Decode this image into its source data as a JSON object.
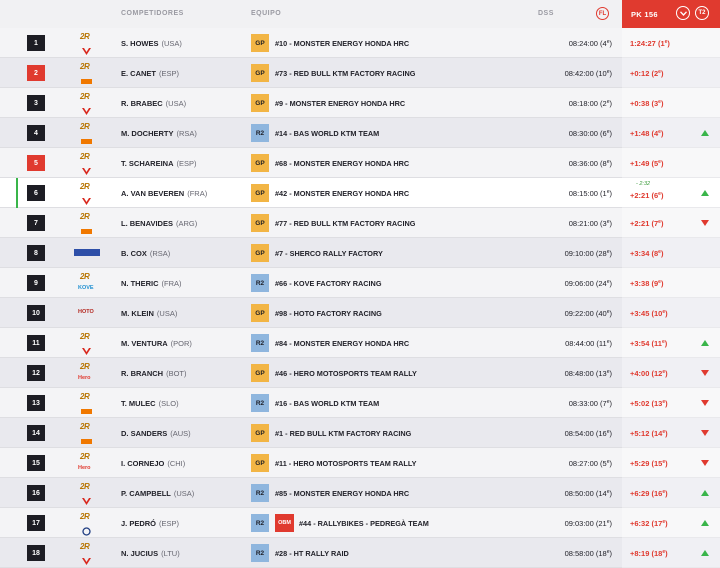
{
  "header": {
    "competitors": "COMPETIDORES",
    "team": "EQUIPO",
    "dss": "DSS",
    "flag_icon_text": "FL",
    "pk": "PK 156",
    "toggle_text": "T2"
  },
  "colors": {
    "accent": "#e03a2f",
    "gp": "#f2b545",
    "r2": "#8fb6de",
    "up": "#39b54a"
  },
  "rows": [
    {
      "rank": "1",
      "name": "S. HOWES",
      "nat": "(USA)",
      "cat": "GP",
      "team": "#10 - MONSTER ENERGY HONDA HRC",
      "dss": "08:24:00",
      "dss_pos": "4",
      "pk": "1:24:27",
      "pk_pos": "1",
      "brand": "2R",
      "mfr": "honda-icon"
    },
    {
      "rank": "2",
      "name": "E. CANET",
      "nat": "(ESP)",
      "cat": "GP",
      "team": "#73 - RED BULL KTM FACTORY RACING",
      "dss": "08:42:00",
      "dss_pos": "10",
      "pk": "+0:12",
      "pk_pos": "2",
      "brand": "2R",
      "mfr": "ktm-icon"
    },
    {
      "rank": "3",
      "name": "R. BRABEC",
      "nat": "(USA)",
      "cat": "GP",
      "team": "#9 - MONSTER ENERGY HONDA HRC",
      "dss": "08:18:00",
      "dss_pos": "2",
      "pk": "+0:38",
      "pk_pos": "3",
      "brand": "2R",
      "mfr": "honda-icon"
    },
    {
      "rank": "4",
      "name": "M. DOCHERTY",
      "nat": "(RSA)",
      "cat": "R2",
      "team": "#14 - BAS WORLD KTM TEAM",
      "dss": "08:30:00",
      "dss_pos": "6",
      "pk": "+1:48",
      "pk_pos": "4",
      "brand": "2R",
      "mfr": "ktm-icon",
      "arrow": "up"
    },
    {
      "rank": "5",
      "name": "T. SCHAREINA",
      "nat": "(ESP)",
      "cat": "GP",
      "team": "#68 - MONSTER ENERGY HONDA HRC",
      "dss": "08:36:00",
      "dss_pos": "8",
      "pk": "+1:49",
      "pk_pos": "5",
      "brand": "2R",
      "mfr": "honda-icon"
    },
    {
      "rank": "6",
      "name": "A. VAN BEVEREN",
      "nat": "(FRA)",
      "cat": "GP",
      "team": "#42 - MONSTER ENERGY HONDA HRC",
      "dss": "08:15:00",
      "dss_pos": "1",
      "pk": "+2:21",
      "pk_pos": "6",
      "penalty": "- 2:32",
      "brand": "2R",
      "mfr": "honda-icon",
      "arrow": "up"
    },
    {
      "rank": "7",
      "name": "L. BENAVIDES",
      "nat": "(ARG)",
      "cat": "GP",
      "team": "#77 - RED BULL KTM FACTORY RACING",
      "dss": "08:21:00",
      "dss_pos": "3",
      "pk": "+2:21",
      "pk_pos": "7",
      "brand": "2R",
      "mfr": "ktm-icon",
      "arrow": "down"
    },
    {
      "rank": "8",
      "name": "B. COX",
      "nat": "(RSA)",
      "cat": "GP",
      "team": "#7 - SHERCO RALLY FACTORY",
      "dss": "09:10:00",
      "dss_pos": "28",
      "pk": "+3:34",
      "pk_pos": "8",
      "logo": "sherco"
    },
    {
      "rank": "9",
      "name": "N. THERIC",
      "nat": "(FRA)",
      "cat": "R2",
      "team": "#66 - KOVE FACTORY RACING",
      "dss": "09:06:00",
      "dss_pos": "24",
      "pk": "+3:38",
      "pk_pos": "9",
      "brand": "2R",
      "logo_text": "KOVE"
    },
    {
      "rank": "10",
      "name": "M. KLEIN",
      "nat": "(USA)",
      "cat": "GP",
      "team": "#98 - HOTO FACTORY RACING",
      "dss": "09:22:00",
      "dss_pos": "40",
      "pk": "+3:45",
      "pk_pos": "10",
      "logo_text": "HOTO"
    },
    {
      "rank": "11",
      "name": "M. VENTURA",
      "nat": "(POR)",
      "cat": "R2",
      "team": "#84 - MONSTER ENERGY HONDA HRC",
      "dss": "08:44:00",
      "dss_pos": "11",
      "pk": "+3:54",
      "pk_pos": "11",
      "brand": "2R",
      "mfr": "honda-icon",
      "arrow": "up"
    },
    {
      "rank": "12",
      "name": "R. BRANCH",
      "nat": "(BOT)",
      "cat": "GP",
      "team": "#46 - HERO MOTOSPORTS TEAM RALLY",
      "dss": "08:48:00",
      "dss_pos": "13",
      "pk": "+4:00",
      "pk_pos": "12",
      "brand": "2R",
      "logo_text": "Hero",
      "arrow": "down"
    },
    {
      "rank": "13",
      "name": "T. MULEC",
      "nat": "(SLO)",
      "cat": "R2",
      "team": "#16 - BAS WORLD KTM TEAM",
      "dss": "08:33:00",
      "dss_pos": "7",
      "pk": "+5:02",
      "pk_pos": "13",
      "brand": "2R",
      "mfr": "ktm-icon",
      "arrow": "down"
    },
    {
      "rank": "14",
      "name": "D. SANDERS",
      "nat": "(AUS)",
      "cat": "GP",
      "team": "#1 - RED BULL KTM FACTORY RACING",
      "dss": "08:54:00",
      "dss_pos": "16",
      "pk": "+5:12",
      "pk_pos": "14",
      "brand": "2R",
      "mfr": "ktm-icon",
      "arrow": "down"
    },
    {
      "rank": "15",
      "name": "I. CORNEJO",
      "nat": "(CHI)",
      "cat": "GP",
      "team": "#11 - HERO MOTOSPORTS TEAM RALLY",
      "dss": "08:27:00",
      "dss_pos": "5",
      "pk": "+5:29",
      "pk_pos": "15",
      "brand": "2R",
      "logo_text": "Hero",
      "arrow": "down"
    },
    {
      "rank": "16",
      "name": "P. CAMPBELL",
      "nat": "(USA)",
      "cat": "R2",
      "team": "#85 - MONSTER ENERGY HONDA HRC",
      "dss": "08:50:00",
      "dss_pos": "14",
      "pk": "+6:29",
      "pk_pos": "16",
      "brand": "2R",
      "mfr": "honda-icon",
      "arrow": "up"
    },
    {
      "rank": "17",
      "name": "J. PEDRÓ",
      "nat": "(ESP)",
      "cat": "R2",
      "obm": "OBM",
      "team": "#44 - RALLYBIKES - PEDREGÀ TEAM",
      "dss": "09:03:00",
      "dss_pos": "21",
      "pk": "+6:32",
      "pk_pos": "17",
      "brand": "2R",
      "mfr": "husqvarna-icon",
      "arrow": "up"
    },
    {
      "rank": "18",
      "name": "N. JUCIUS",
      "nat": "(LTU)",
      "cat": "R2",
      "team": "#28 - HT RALLY RAID",
      "dss": "08:58:00",
      "dss_pos": "18",
      "pk": "+8:19",
      "pk_pos": "18",
      "brand": "2R",
      "mfr": "honda-icon",
      "arrow": "up"
    }
  ]
}
